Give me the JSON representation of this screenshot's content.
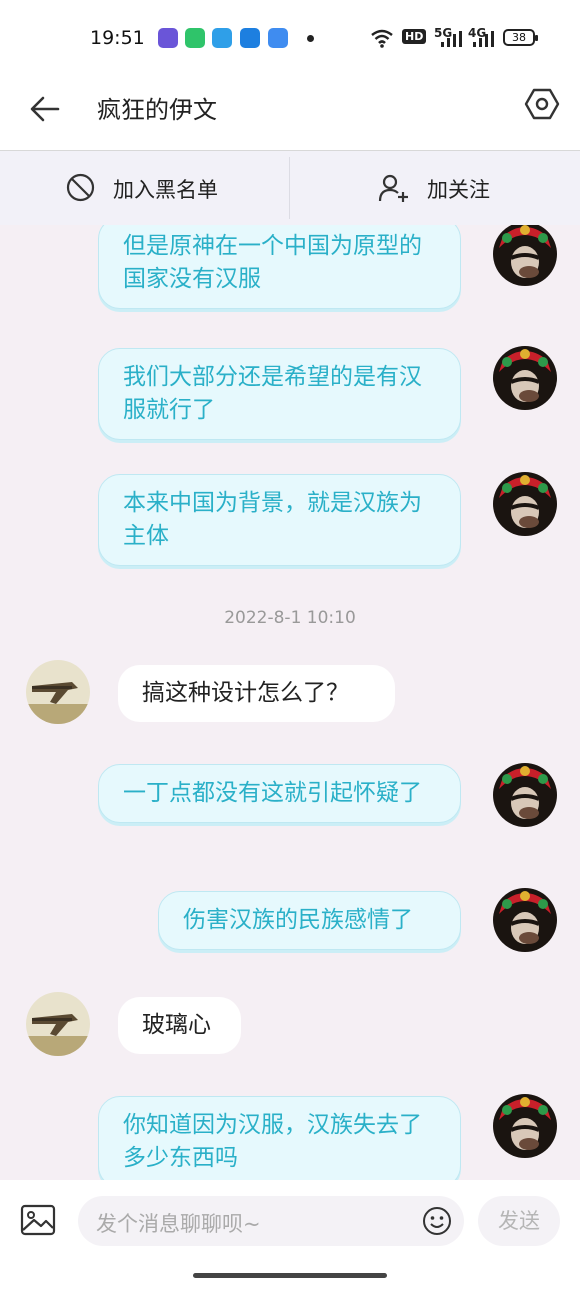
{
  "status": {
    "time": "19:51",
    "network_hd": "HD",
    "sig1": "5G",
    "sig2": "4G",
    "battery": "38"
  },
  "header": {
    "title": "疯狂的伊文"
  },
  "actions": {
    "blacklist": "加入黑名单",
    "follow": "加关注"
  },
  "messages": [
    {
      "side": "mine",
      "text": "但是原神在一个中国为原型的国家没有汉服"
    },
    {
      "side": "mine",
      "text": "我们大部分还是希望的是有汉服就行了"
    },
    {
      "side": "mine",
      "text": "本来中国为背景，就是汉族为主体"
    },
    {
      "side": "timestamp",
      "text": "2022-8-1 10:10"
    },
    {
      "side": "other",
      "text": "搞这种设计怎么了？"
    },
    {
      "side": "mine",
      "text": "一丁点都没有这就引起怀疑了"
    },
    {
      "side": "mine",
      "text": "伤害汉族的民族感情了"
    },
    {
      "side": "other",
      "text": "玻璃心"
    },
    {
      "side": "mine",
      "text": "你知道因为汉服，汉族失去了多少东西吗"
    }
  ],
  "input": {
    "placeholder": "发个消息聊聊呗~",
    "send": "发送"
  },
  "colors": {
    "mine_bubble_bg": "#e6f9fd",
    "mine_text": "#2ab0c8",
    "other_bubble_bg": "#ffffff",
    "chat_bg": "#f5eff4"
  }
}
